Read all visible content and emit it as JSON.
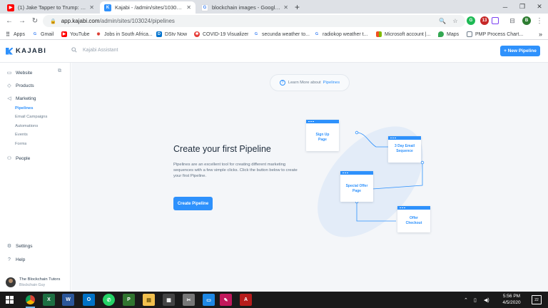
{
  "browser": {
    "tabs": [
      {
        "title": "(1) Jake Tapper to Trump: This re",
        "favicon": "youtube-icon",
        "color": "#ff0000"
      },
      {
        "title": "Kajabi - /admin/sites/103024/pip",
        "favicon": "kajabi-icon",
        "color": "#2e91fc"
      },
      {
        "title": "blockchain images - Google Sea",
        "favicon": "google-icon",
        "color": "#4285f4"
      }
    ],
    "url_host": "app.kajabi.com",
    "url_path": "/admin/sites/103024/pipelines",
    "profile_initial": "B",
    "extension_badge": "13"
  },
  "bookmarks": [
    {
      "label": "Apps",
      "icon": "apps-grid-icon",
      "color": "#5f6368"
    },
    {
      "label": "Gmail",
      "icon": "google-icon",
      "color": "#4285f4"
    },
    {
      "label": "YouTube",
      "icon": "youtube-icon",
      "color": "#ff0000"
    },
    {
      "label": "Jobs in South Africa...",
      "icon": "jobs-icon",
      "color": "#d93025"
    },
    {
      "label": "DStv Now",
      "icon": "dstv-icon",
      "color": "#0072ce"
    },
    {
      "label": "COVID-19 Visualizer",
      "icon": "covid-icon",
      "color": "#e53935"
    },
    {
      "label": "secunda weather to...",
      "icon": "google-icon",
      "color": "#4285f4"
    },
    {
      "label": "radiokop weather t...",
      "icon": "google-icon",
      "color": "#4285f4"
    },
    {
      "label": "Microsoft account |...",
      "icon": "microsoft-icon",
      "color": "#f25022"
    },
    {
      "label": "Maps",
      "icon": "maps-icon",
      "color": "#34a853"
    },
    {
      "label": "PMP Process Chart...",
      "icon": "document-icon",
      "color": "#6d7b8a"
    }
  ],
  "kajabi": {
    "logo_text": "KAJABI",
    "search_placeholder": "Kajabi Assistant",
    "new_pipeline_label": "+ New Pipeline",
    "sidebar": {
      "website": "Website",
      "products": "Products",
      "marketing": "Marketing",
      "sub_items": [
        "Pipelines",
        "Email Campaigns",
        "Automations",
        "Events",
        "Forms"
      ],
      "people": "People",
      "settings": "Settings",
      "help": "Help",
      "user_name": "The Blockchain Tutors",
      "user_role": "Blockchain Guy"
    },
    "learn_prefix": "Learn More about",
    "learn_link": "Pipelines",
    "hero_title": "Create your first Pipeline",
    "hero_desc": "Pipelines are an excellent tool for creating different marketing sequences with a few simple clicks. Click the button below to create your first Pipeline.",
    "cta_label": "Create Pipeline",
    "diagram_cards": [
      "Sign Up Page",
      "3 Day Email Sequence",
      "Special Offer Page",
      "Offer Checkout"
    ],
    "accent_color": "#2e91fc"
  },
  "taskbar": {
    "time": "5:56 PM",
    "date": "4/5/2020",
    "notification_count": "22"
  }
}
